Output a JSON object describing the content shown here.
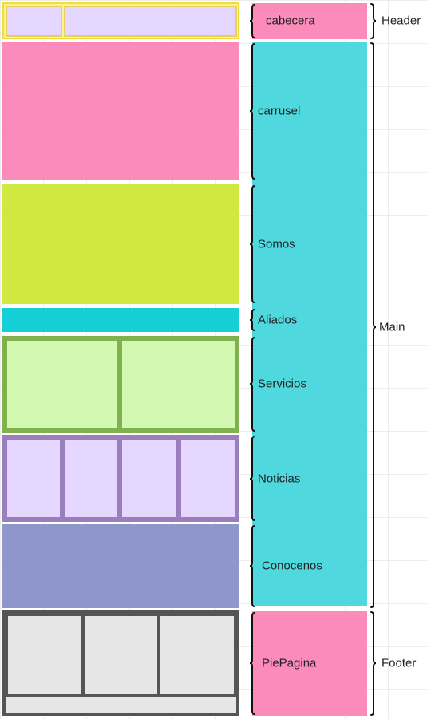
{
  "sections": {
    "cabecera": "cabecera",
    "carrusel": "carrusel",
    "somos": "Somos",
    "aliados": "Aliados",
    "servicios": "Servicios",
    "noticias": "Noticias",
    "conocenos": "Conocenos",
    "piepagina": "PiePagina"
  },
  "groups": {
    "header": "Header",
    "main": "Main",
    "footer": "Footer"
  },
  "colors": {
    "header_block": "#fff38c",
    "header_cell": "#e5d7ff",
    "carrusel": "#fa8bba",
    "somos": "#d0e842",
    "aliados": "#14cfd6",
    "servicios_block": "#d3f8b0",
    "servicios_border": "#7fb14f",
    "noticias_block": "#e5d7ff",
    "noticias_border": "#9b7fbd",
    "conocenos": "#8f96c9",
    "footer_block": "#e6e6e6",
    "footer_border": "#555555",
    "label_pink": "#fa8bba",
    "label_cyan": "#4fd8de"
  }
}
